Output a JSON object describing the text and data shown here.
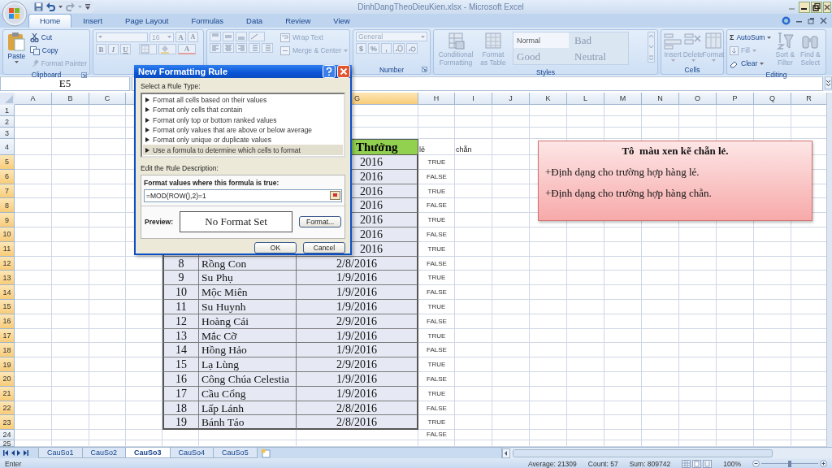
{
  "title_bar": {
    "title": "DinhDangTheoDieuKien.xlsx - Microsoft Excel"
  },
  "ribbon_tabs": [
    {
      "label": "Home",
      "selected": true
    },
    {
      "label": "Insert",
      "selected": false
    },
    {
      "label": "Page Layout",
      "selected": false
    },
    {
      "label": "Formulas",
      "selected": false
    },
    {
      "label": "Data",
      "selected": false
    },
    {
      "label": "Review",
      "selected": false
    },
    {
      "label": "View",
      "selected": false
    }
  ],
  "ribbon": {
    "clipboard": {
      "paste": "Paste",
      "cut": "Cut",
      "copy": "Copy",
      "format_painter": "Format Painter",
      "label": "Clipboard"
    },
    "font": {
      "size": "16",
      "grow": "A",
      "shrink": "A",
      "bold": "B",
      "italic": "I",
      "underline": "U",
      "font_color": "A"
    },
    "alignment": {
      "wrap_text": "Wrap Text",
      "merge_center": "Merge & Center"
    },
    "number": {
      "format": "General",
      "currency": "$",
      "percent": "%",
      "comma": ",",
      "label": "Number"
    },
    "styles": {
      "conditional_formatting": "Conditional Formatting",
      "format_as_table": "Format as Table",
      "cell_styles": [
        {
          "label": "Normal",
          "kind": "normal"
        },
        {
          "label": "Bad",
          "kind": "bad"
        },
        {
          "label": "Good",
          "kind": "good"
        },
        {
          "label": "Neutral",
          "kind": "neutral"
        }
      ],
      "label": "Styles"
    },
    "cells": {
      "buttons": [
        "Insert",
        "Delete",
        "Format"
      ],
      "label": "Cells"
    },
    "editing": {
      "autosum_symbol": "Σ",
      "autosum": "AutoSum",
      "fill": "Fill",
      "clear": "Clear",
      "sort_filter": "Sort & Filter",
      "find_select": "Find & Select",
      "label": "Editing"
    }
  },
  "formula_bar": {
    "name_box": "E5"
  },
  "sheet": {
    "columns": [
      {
        "label": "A",
        "selected": false
      },
      {
        "label": "B",
        "selected": false
      },
      {
        "label": "C",
        "selected": false
      },
      {
        "selected": false
      },
      {
        "label": "G",
        "selected": true
      },
      {
        "label": "H",
        "selected": false
      },
      {
        "label": "I",
        "selected": false
      },
      {
        "label": "J",
        "selected": false
      },
      {
        "label": "K",
        "selected": false
      },
      {
        "label": "L",
        "selected": false
      },
      {
        "label": "M",
        "selected": false
      },
      {
        "label": "N",
        "selected": false
      },
      {
        "label": "O",
        "selected": false
      },
      {
        "label": "P",
        "selected": false
      },
      {
        "label": "Q",
        "selected": false
      },
      {
        "label": "R",
        "selected": false
      }
    ],
    "rows": [
      {
        "label": "1",
        "selected": false
      },
      {
        "label": "2",
        "selected": false
      },
      {
        "label": "3",
        "selected": false
      },
      {
        "label": "4",
        "selected": false
      },
      {
        "label": "5",
        "selected": true
      },
      {
        "label": "6",
        "selected": true
      },
      {
        "label": "7",
        "selected": true
      },
      {
        "label": "8",
        "selected": true
      },
      {
        "label": "9",
        "selected": true
      },
      {
        "label": "10",
        "selected": true
      },
      {
        "label": "11",
        "selected": true
      },
      {
        "label": "12",
        "selected": true
      },
      {
        "label": "13",
        "selected": true
      },
      {
        "label": "14",
        "selected": true
      },
      {
        "label": "15",
        "selected": true
      },
      {
        "label": "16",
        "selected": true
      },
      {
        "label": "17",
        "selected": true
      },
      {
        "label": "18",
        "selected": true
      },
      {
        "label": "19",
        "selected": true
      },
      {
        "label": "20",
        "selected": true
      },
      {
        "label": "21",
        "selected": true
      },
      {
        "label": "22",
        "selected": true
      },
      {
        "label": "23",
        "selected": true
      },
      {
        "label": "24",
        "selected": false
      },
      {
        "label": "25",
        "selected": false
      }
    ],
    "table_header": "Thưởng",
    "flag_headers": [
      "lẻ",
      "chẵn"
    ],
    "table_rows": [
      {
        "kind": "partial",
        "date": "2016"
      },
      {
        "kind": "partial",
        "date": "2016"
      },
      {
        "kind": "partial",
        "date": "2016"
      },
      {
        "kind": "partial",
        "date": "2016"
      },
      {
        "kind": "partial",
        "date": "2016"
      },
      {
        "kind": "partial",
        "date": "2016"
      },
      {
        "kind": "partial",
        "date": "2016"
      },
      {
        "kind": "full",
        "number": "8",
        "name": "Rồng Con",
        "date": "2/8/2016"
      },
      {
        "kind": "full",
        "number": "9",
        "name": "Su Phụ",
        "date": "1/9/2016"
      },
      {
        "kind": "full",
        "number": "10",
        "name": "Mộc Miên",
        "date": "1/9/2016"
      },
      {
        "kind": "full",
        "number": "11",
        "name": "Su Huynh",
        "date": "1/9/2016"
      },
      {
        "kind": "full",
        "number": "12",
        "name": "Hoàng Cái",
        "date": "2/9/2016"
      },
      {
        "kind": "full",
        "number": "13",
        "name": "Mắc Cỡ",
        "date": "1/9/2016"
      },
      {
        "kind": "full",
        "number": "14",
        "name": "Hồng Hảo",
        "date": "1/9/2016"
      },
      {
        "kind": "full",
        "number": "15",
        "name": "Lạ Lùng",
        "date": "2/9/2016"
      },
      {
        "kind": "full",
        "number": "16",
        "name": "Công Chúa Celestia",
        "date": "1/9/2016"
      },
      {
        "kind": "full",
        "number": "17",
        "name": "Cầu Cổng",
        "date": "1/9/2016"
      },
      {
        "kind": "full",
        "number": "18",
        "name": "Lấp Lánh",
        "date": "2/8/2016"
      },
      {
        "kind": "full",
        "number": "19",
        "name": "Bánh Táo",
        "date": "2/8/2016"
      }
    ],
    "parity_flags": [
      "TRUE",
      "FALSE",
      "TRUE",
      "FALSE",
      "TRUE",
      "FALSE",
      "TRUE",
      "FALSE",
      "TRUE",
      "FALSE",
      "TRUE",
      "FALSE",
      "TRUE",
      "FALSE",
      "TRUE",
      "FALSE",
      "TRUE",
      "FALSE",
      "TRUE",
      "FALSE"
    ]
  },
  "note": {
    "title": "Tô  màu xen kẽ chẵn lẻ.",
    "lines": [
      "+Định dạng cho trường hợp hàng lẻ.",
      "+Định dạng cho trường hợp hàng chẵn."
    ]
  },
  "dialog": {
    "title": "New Formatting Rule",
    "rule_type_label": "Select a Rule Type:",
    "rule_types": [
      {
        "label": "Format all cells based on their values",
        "selected": false
      },
      {
        "label": "Format only cells that contain",
        "selected": false
      },
      {
        "label": "Format only top or bottom ranked values",
        "selected": false
      },
      {
        "label": "Format only values that are above or below average",
        "selected": false
      },
      {
        "label": "Format only unique or duplicate values",
        "selected": false
      },
      {
        "label": "Use a formula to determine which cells to format",
        "selected": true
      }
    ],
    "description_label": "Edit the Rule Description:",
    "formula_label": "Format values where this formula is true:",
    "formula": "=MOD(ROW(),2)=1",
    "preview_label": "Preview:",
    "preview_text": "No Format Set",
    "format_button": "Format...",
    "buttons": [
      "OK",
      "Cancel"
    ]
  },
  "sheet_tabs": [
    {
      "label": "CauSo1",
      "selected": false
    },
    {
      "label": "CauSo2",
      "selected": false
    },
    {
      "label": "CauSo3",
      "selected": true
    },
    {
      "label": "CauSo4",
      "selected": false
    },
    {
      "label": "CauSo5",
      "selected": false
    }
  ],
  "status_bar": {
    "mode": "Enter",
    "average": "Average: 21309",
    "count": "Count: 57",
    "sum": "Sum: 809742",
    "zoom": "100%",
    "zoom_slider": {
      "level": 0.5
    }
  }
}
